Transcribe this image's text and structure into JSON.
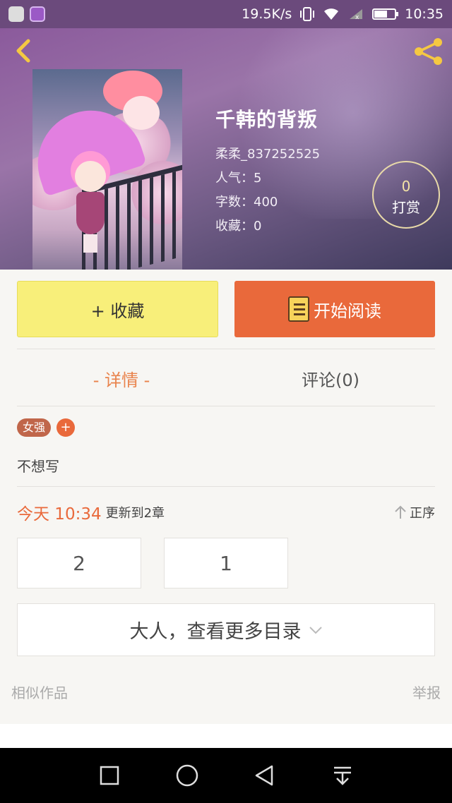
{
  "status_bar": {
    "speed": "19.5K/s",
    "time": "10:35",
    "battery_level": 0.65
  },
  "book": {
    "title": "千韩的背叛",
    "author": "柔柔_837252525",
    "popularity": "人气：5",
    "word_count": "字数：400",
    "favorites": "收藏：0"
  },
  "tip": {
    "count": "0",
    "label": "打赏"
  },
  "actions": {
    "collect_label": "+ 收藏",
    "read_label": "开始阅读"
  },
  "tabs": [
    {
      "label": "- 详情 -",
      "active": true
    },
    {
      "label": "评论(0)",
      "active": false
    }
  ],
  "tags": {
    "items": [
      "女强"
    ],
    "add_symbol": "+"
  },
  "description": "不想写",
  "update": {
    "time": "今天 10:34",
    "text": "更新到2章",
    "order_label": "正序"
  },
  "chapters": [
    "2",
    "1"
  ],
  "more_catalog_label": "大人，查看更多目录",
  "footer": {
    "similar_label": "相似作品",
    "report_label": "举报"
  },
  "colors": {
    "accent": "#e9693b",
    "collect_bg": "#f8ef7a",
    "tab_active": "#e9834c"
  },
  "icons": {
    "back": "chevron-left-icon",
    "share": "share-icon",
    "book": "book-icon",
    "order": "arrow-up-icon",
    "more": "chevron-down-icon"
  }
}
